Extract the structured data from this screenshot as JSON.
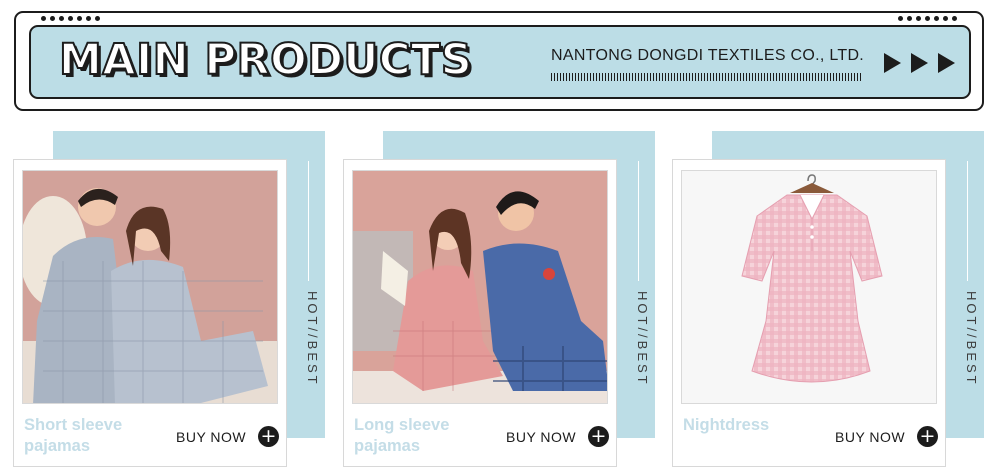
{
  "banner": {
    "title": "MAIN PRODUCTS",
    "company": "NANTONG DONGDI TEXTILES CO., LTD."
  },
  "cards": [
    {
      "name_line1": "Short sleeve",
      "name_line2": "pajamas",
      "buy_label": "BUY NOW",
      "side_label": "HOT//BEST",
      "image": "couple in short-sleeve plaid pajamas"
    },
    {
      "name_line1": "Long sleeve",
      "name_line2": "pajamas",
      "buy_label": "BUY NOW",
      "side_label": "HOT//BEST",
      "image": "couple in long-sleeve pajamas"
    },
    {
      "name_line1": "Nightdress",
      "name_line2": "",
      "buy_label": "BUY NOW",
      "side_label": "HOT//BEST",
      "image": "pink gingham nightdress"
    }
  ],
  "icons": [
    "play-arrow-icon",
    "plus-circle-icon"
  ],
  "colors": {
    "accent": "#bcdde6",
    "dark": "#1c1c1c",
    "name_text": "#c4dde7",
    "gingham": "#f0a9bb"
  }
}
